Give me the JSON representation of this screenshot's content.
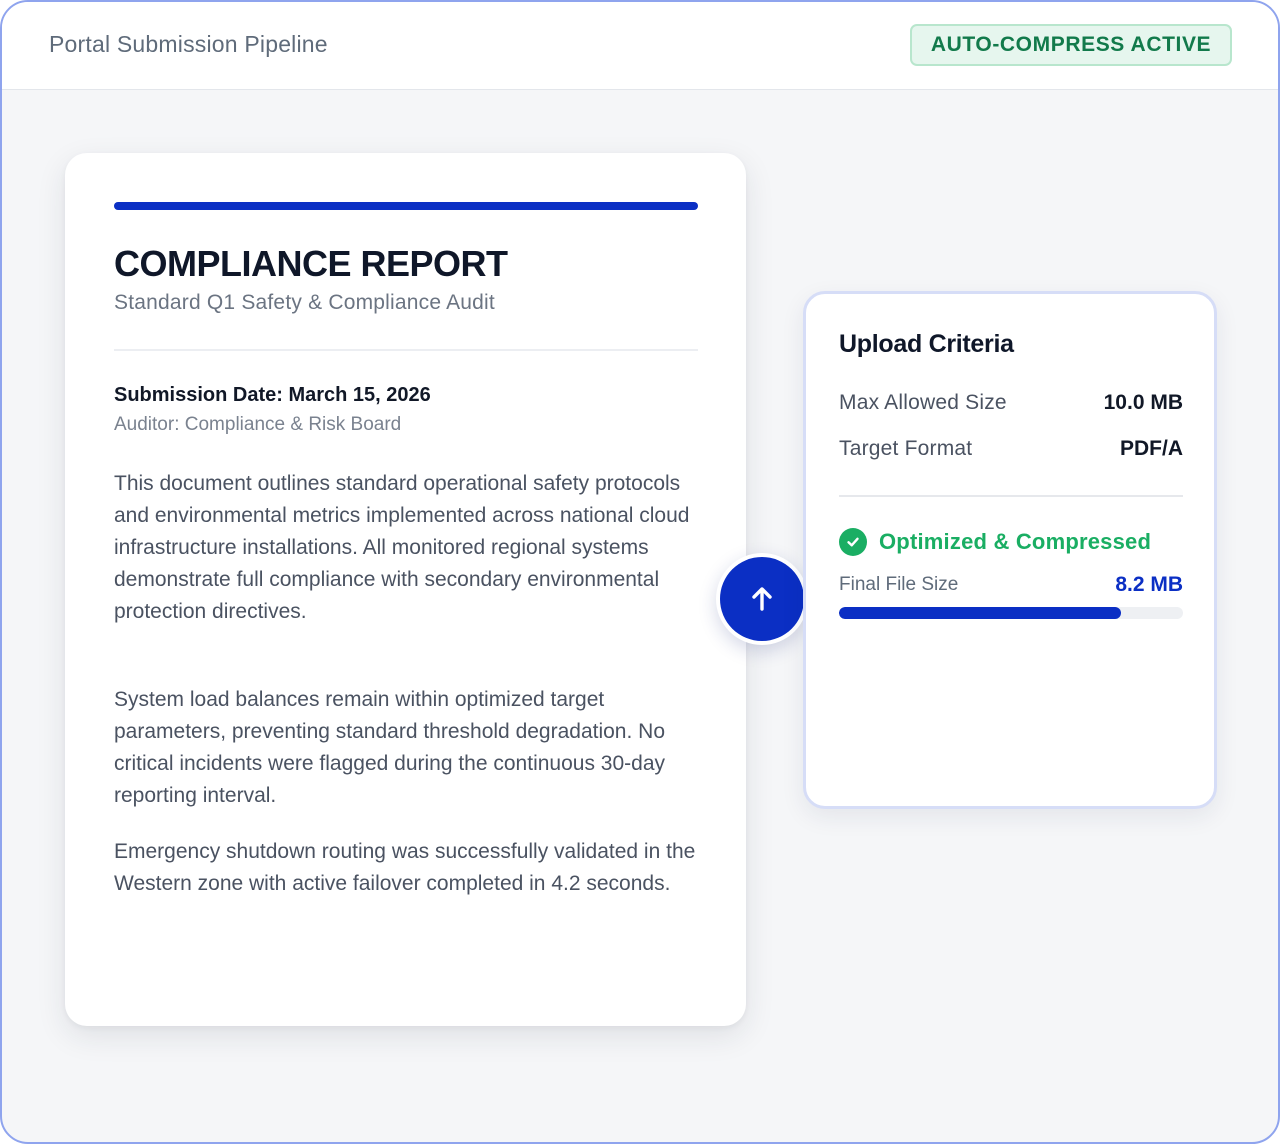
{
  "header": {
    "title": "Portal Submission Pipeline",
    "badge": "AUTO-COMPRESS ACTIVE"
  },
  "document": {
    "title": "COMPLIANCE REPORT",
    "subtitle": "Standard Q1 Safety & Compliance Audit",
    "submission_date": "Submission Date: March 15, 2026",
    "auditor": "Auditor: Compliance & Risk Board",
    "paragraphs": [
      "This document outlines standard operational safety protocols and environmental metrics implemented across national cloud infrastructure installations. All monitored regional systems demonstrate full compliance with secondary environmental protection directives.",
      "System load balances remain within optimized target parameters, preventing standard threshold degradation. No critical incidents were flagged during the continuous 30-day reporting interval.",
      "Emergency shutdown routing was successfully validated in the Western zone with active failover completed in 4.2 seconds."
    ]
  },
  "upload_button": {
    "icon": "arrow-up-icon"
  },
  "criteria": {
    "heading": "Upload Criteria",
    "rows": [
      {
        "label": "Max Allowed Size",
        "value": "10.0 MB"
      },
      {
        "label": "Target Format",
        "value": "PDF/A"
      }
    ],
    "status": {
      "icon": "check-circle-icon",
      "text": "Optimized & Compressed"
    },
    "final_size": {
      "label": "Final File Size",
      "value": "8.2 MB",
      "fraction_of_max": 0.82
    }
  },
  "colors": {
    "accent": "#0b2fc4",
    "success": "#1aae63",
    "badge_bg": "#e6f6ee",
    "badge_text": "#127a4b"
  }
}
